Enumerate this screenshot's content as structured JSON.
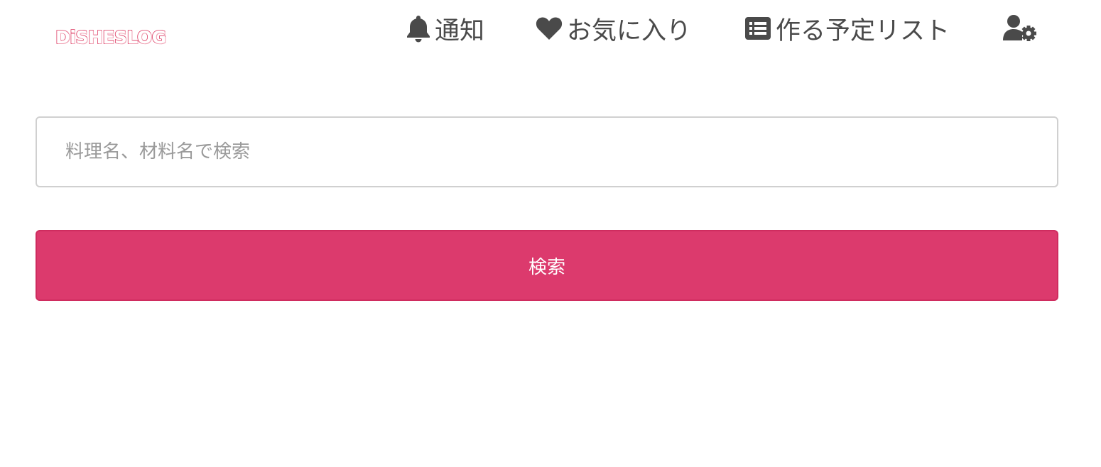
{
  "header": {
    "logo_text": "DiSHESLOG",
    "nav": {
      "notifications": {
        "icon": "bell-icon",
        "label": "通知"
      },
      "favorites": {
        "icon": "heart-icon",
        "label": "お気に入り"
      },
      "todo_list": {
        "icon": "list-icon",
        "label": "作る予定リスト"
      },
      "account": {
        "icon": "user-cog-icon"
      }
    }
  },
  "search": {
    "placeholder": "料理名、材料名で検索",
    "value": "",
    "button_label": "検索"
  },
  "colors": {
    "accent": "#dc3a6d",
    "logo": "#dd3a62",
    "nav_text": "#4a4a4a",
    "input_border": "#d0d0d0"
  }
}
